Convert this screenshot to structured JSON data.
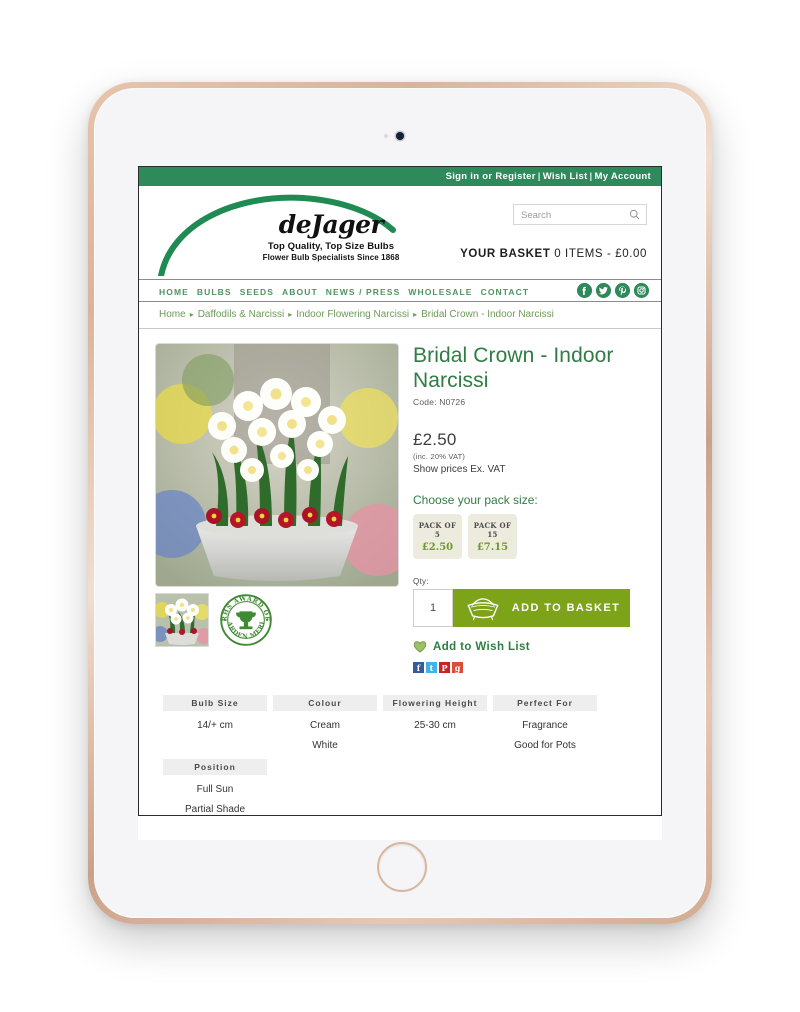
{
  "device": {
    "type": "tablet",
    "finish": "rose-gold"
  },
  "utility_bar": {
    "sign_in": "Sign in or Register",
    "wish_list": "Wish List",
    "my_account": "My Account",
    "separator": "|"
  },
  "logo": {
    "wordmark": "deJager",
    "tagline1": "Top Quality, Top Size Bulbs",
    "tagline2": "Flower Bulb Specialists Since 1868"
  },
  "search": {
    "placeholder": "Search",
    "value": "",
    "icon": "search-icon"
  },
  "basket": {
    "label": "YOUR BASKET",
    "summary": "0 ITEMS - £0.00"
  },
  "nav": {
    "items": [
      {
        "label": "HOME"
      },
      {
        "label": "BULBS"
      },
      {
        "label": "SEEDS"
      },
      {
        "label": "ABOUT"
      },
      {
        "label": "NEWS / PRESS"
      },
      {
        "label": "WHOLESALE"
      },
      {
        "label": "CONTACT"
      }
    ],
    "social": [
      {
        "name": "facebook-icon",
        "glyph": "f"
      },
      {
        "name": "twitter-icon",
        "glyph": "t"
      },
      {
        "name": "pinterest-icon",
        "glyph": "P"
      },
      {
        "name": "instagram-icon",
        "glyph": "i"
      }
    ]
  },
  "breadcrumb": {
    "separator": "▸",
    "items": [
      {
        "label": "Home"
      },
      {
        "label": "Daffodils & Narcissi"
      },
      {
        "label": "Indoor Flowering Narcissi"
      },
      {
        "label": "Bridal Crown - Indoor Narcissi"
      }
    ]
  },
  "product": {
    "title": "Bridal Crown - Indoor Narcissi",
    "code": "Code: N0726",
    "price": "£2.50",
    "vat_note": "(inc. 20% VAT)",
    "vat_toggle": "Show prices Ex. VAT",
    "pack_label": "Choose your pack size:",
    "packs": [
      {
        "name": "PACK OF",
        "count": "5",
        "price": "£2.50"
      },
      {
        "name": "PACK OF",
        "count": "15",
        "price": "£7.15"
      }
    ],
    "qty_label": "Qty:",
    "qty_value": "1",
    "add_to_basket": "ADD TO BASKET",
    "wish_list": "Add to Wish List",
    "image_alt": "Bridal Crown white double narcissi in grey pot",
    "award_badge": "RHS AWARD OF GARDEN MERIT",
    "share": [
      {
        "name": "facebook-share-icon",
        "glyph": "f",
        "color": "#3b5998"
      },
      {
        "name": "twitter-share-icon",
        "glyph": "t",
        "color": "#44b2e8"
      },
      {
        "name": "pinterest-share-icon",
        "glyph": "P",
        "color": "#cc2127"
      },
      {
        "name": "googleplus-share-icon",
        "glyph": "g",
        "color": "#dd4b39"
      }
    ]
  },
  "attributes": {
    "row1": [
      {
        "header": "Bulb Size",
        "values": [
          "14/+ cm"
        ]
      },
      {
        "header": "Colour",
        "values": [
          "Cream",
          "White"
        ]
      },
      {
        "header": "Flowering Height",
        "values": [
          "25-30 cm"
        ]
      },
      {
        "header": "Perfect For",
        "values": [
          "Fragrance",
          "Good for Pots"
        ]
      }
    ],
    "row2": [
      {
        "header": "Position",
        "values": [
          "Full Sun",
          "Partial Shade"
        ]
      }
    ]
  },
  "colors": {
    "header_green": "#2f8a5b",
    "nav_green": "#4f9460",
    "title_green": "#2f7d43",
    "basket_green": "#7da319",
    "pack_bg": "#edeade",
    "price_green": "#6f9b2e"
  }
}
